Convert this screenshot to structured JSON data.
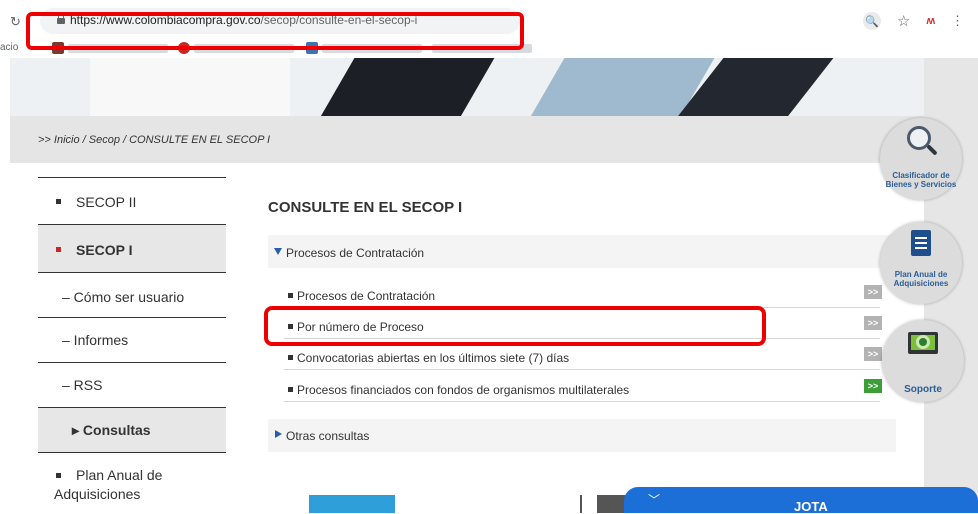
{
  "browser": {
    "url_host": "https://www.colombiacompra.gov.co",
    "url_path": "/secop/consulte-en-el-secop-i",
    "bookmarks_left_text": "acio"
  },
  "breadcrumb": ">> Inicio / Secop / CONSULTE EN EL SECOP I",
  "sidebar": {
    "items": [
      {
        "label": "SECOP II"
      },
      {
        "label": "SECOP I"
      },
      {
        "label": "– Cómo ser usuario"
      },
      {
        "label": "– Informes"
      },
      {
        "label": "– RSS"
      },
      {
        "label": "▸ Consultas"
      },
      {
        "label": "Plan Anual de"
      },
      {
        "label": "Adquisiciones"
      }
    ]
  },
  "main": {
    "title": "CONSULTE EN EL SECOP I",
    "accordion1": "Procesos de Contratación",
    "links": [
      {
        "label": "Procesos de Contratación",
        "arrow": ">>"
      },
      {
        "label": "Por número de Proceso",
        "arrow": ">>"
      },
      {
        "label": "Convocatorias abiertas en los últimos siete (7) días",
        "arrow": ">>"
      },
      {
        "label": "Procesos financiados con fondos de organismos multilaterales",
        "arrow": ">>"
      }
    ],
    "accordion2": "Otras consultas"
  },
  "widgets": {
    "clasificador_line1": "Clasificador de",
    "clasificador_line2": "Bienes y Servicios",
    "plan_line1": "Plan Anual de",
    "plan_line2": "Adquisiciones",
    "soporte": "Soporte"
  },
  "chat": {
    "label": "JOTA"
  },
  "colors": {
    "highlight": "#ee0000",
    "accent_blue": "#2a5ea8",
    "green_arrow": "#3c9e36",
    "chat_blue": "#1d6fd8"
  }
}
